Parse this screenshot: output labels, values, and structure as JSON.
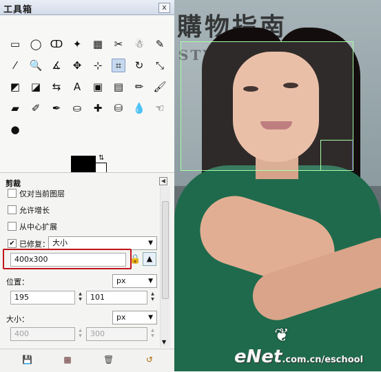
{
  "window": {
    "title": "工具箱",
    "close_label": "x"
  },
  "tools": [
    {
      "icon": "rect-select-icon",
      "glyph": "▭"
    },
    {
      "icon": "ellipse-select-icon",
      "glyph": "◯"
    },
    {
      "icon": "free-select-icon",
      "glyph": "ↀ"
    },
    {
      "icon": "fuzzy-select-icon",
      "glyph": "✦"
    },
    {
      "icon": "color-select-icon",
      "glyph": "▦"
    },
    {
      "icon": "scissors-icon",
      "glyph": "✂"
    },
    {
      "icon": "foreground-select-icon",
      "glyph": "☃"
    },
    {
      "icon": "paths-icon",
      "glyph": "✎"
    },
    {
      "icon": "color-picker-icon",
      "glyph": "⁄"
    },
    {
      "icon": "zoom-icon",
      "glyph": "🔍"
    },
    {
      "icon": "measure-icon",
      "glyph": "∡"
    },
    {
      "icon": "move-icon",
      "glyph": "✥"
    },
    {
      "icon": "align-icon",
      "glyph": "⊹"
    },
    {
      "icon": "crop-icon",
      "glyph": "⌗"
    },
    {
      "icon": "rotate-icon",
      "glyph": "↻"
    },
    {
      "icon": "scale-icon",
      "glyph": "⤡"
    },
    {
      "icon": "shear-icon",
      "glyph": "◩"
    },
    {
      "icon": "perspective-icon",
      "glyph": "◪"
    },
    {
      "icon": "flip-icon",
      "glyph": "⇆"
    },
    {
      "icon": "text-icon",
      "glyph": "A"
    },
    {
      "icon": "bucket-fill-icon",
      "glyph": "▣"
    },
    {
      "icon": "blend-icon",
      "glyph": "▤"
    },
    {
      "icon": "pencil-icon",
      "glyph": "✏"
    },
    {
      "icon": "paintbrush-icon",
      "glyph": "🖌"
    },
    {
      "icon": "eraser-icon",
      "glyph": "▰"
    },
    {
      "icon": "airbrush-icon",
      "glyph": "✐"
    },
    {
      "icon": "ink-icon",
      "glyph": "✒"
    },
    {
      "icon": "clone-icon",
      "glyph": "⛀"
    },
    {
      "icon": "heal-icon",
      "glyph": "✚"
    },
    {
      "icon": "perspective-clone-icon",
      "glyph": "⛁"
    },
    {
      "icon": "blur-icon",
      "glyph": "💧"
    },
    {
      "icon": "smudge-icon",
      "glyph": "☜"
    },
    {
      "icon": "dodge-burn-icon",
      "glyph": "●"
    }
  ],
  "active_tool_index": 13,
  "colors": {
    "foreground": "#000000",
    "background": "#ffffff",
    "accent_highlight": "#c0141b"
  },
  "options": {
    "header": "剪裁",
    "current_layer_only": {
      "label": "仅对当前图层",
      "checked": false
    },
    "allow_growing": {
      "label": "允许增长",
      "checked": false
    },
    "expand_from_center": {
      "label": "从中心扩展",
      "checked": false
    },
    "fixed": {
      "label": "已修复：",
      "checked": true,
      "mode": "大小"
    },
    "size_field": "400x300",
    "position": {
      "label": "位置：",
      "unit": "px",
      "x": "195",
      "y": "101"
    },
    "size": {
      "label": "大小：",
      "unit": "px",
      "w": "400",
      "h": "300"
    }
  },
  "photo": {
    "bg_text": "購物指南",
    "bg_text2": "STYLE",
    "logo_main": "eNet",
    "logo_suffix": ".com.cn/eschool"
  }
}
